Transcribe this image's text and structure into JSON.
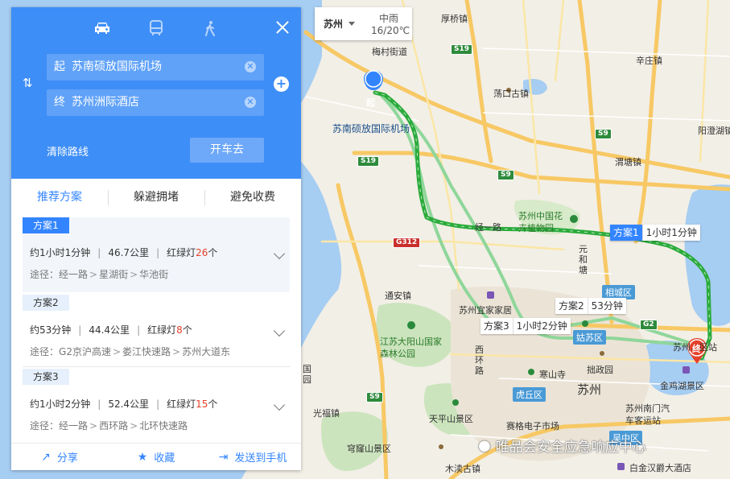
{
  "panel": {
    "modes": [
      {
        "name": "car",
        "icon": "car-icon",
        "active": true
      },
      {
        "name": "bus",
        "icon": "bus-icon",
        "active": false
      },
      {
        "name": "walk",
        "icon": "walk-icon",
        "active": false
      }
    ],
    "origin": {
      "label": "起",
      "value": "苏南硕放国际机场"
    },
    "destination": {
      "label": "终",
      "value": "苏州洲际酒店"
    },
    "clear_route": "清除路线",
    "drive_button": "开车去",
    "preferences": [
      "推荐方案",
      "躲避拥堵",
      "避免收费"
    ],
    "plans": [
      {
        "tag": "方案1",
        "time": "约1小时1分钟",
        "distance": "46.7公里",
        "lights_label": "红绿灯",
        "lights_count": "26",
        "lights_unit": "个",
        "path_label": "途径：",
        "path": [
          "经一路",
          "星湖街",
          "华池街"
        ]
      },
      {
        "tag": "方案2",
        "time": "约53分钟",
        "distance": "44.4公里",
        "lights_label": "红绿灯",
        "lights_count": "8",
        "lights_unit": "个",
        "path_label": "途径：",
        "path": [
          "G2京沪高速",
          "娄江快速路",
          "苏州大道东"
        ]
      },
      {
        "tag": "方案3",
        "time": "约1小时2分钟",
        "distance": "52.4公里",
        "lights_label": "红绿灯",
        "lights_count": "15",
        "lights_unit": "个",
        "path_label": "途径：",
        "path": [
          "经一路",
          "西环路",
          "北环快速路"
        ]
      }
    ],
    "footer": [
      {
        "label": "分享",
        "icon": "share-icon"
      },
      {
        "label": "收藏",
        "icon": "star-icon"
      },
      {
        "label": "发送到手机",
        "icon": "send-to-phone-icon"
      }
    ]
  },
  "weather": {
    "city": "苏州",
    "condition": "中雨",
    "temperature": "16/20℃"
  },
  "map": {
    "start_marker": "起",
    "end_marker": "终",
    "start_name": "苏南硕放国际机场",
    "route_tags": [
      {
        "name": "方案1",
        "time": "1小时1分钟",
        "active": true
      },
      {
        "name": "方案2",
        "time": "53分钟",
        "active": false
      },
      {
        "name": "方案3",
        "time": "1小时2分钟",
        "active": false
      }
    ],
    "labels": {
      "meicun": "梅村街道",
      "houqiao": "厚桥镇",
      "dangkou": "荡口古镇",
      "xinzhuang": "辛庄镇",
      "yangcheng": "阳澄湖镇",
      "weitang": "渭塘镇",
      "botanic": "苏州中国花卉植物园",
      "jingyi": "经一路",
      "yuanhetang": "元和塘",
      "furniture": "苏州宜家家居",
      "dayangshan": "江苏大阳山国家森林公园",
      "tongan": "通安镇",
      "xihuan": "西环路",
      "hanshan": "寒山寺",
      "suzhou": "苏州",
      "zhuozheng": "拙政园",
      "jinji": "金鸡湖景区",
      "tianping": "天平山景区",
      "saige": "赛格电子市场",
      "nanmen": "苏州南门汽车客运站",
      "guangfu": "光福镇",
      "qionglong": "穹窿山景区",
      "mudu": "木渎古镇",
      "baijin": "白金汉爵大酒店",
      "dongtaihu": "东太湖",
      "suzhou_east": "苏州…区站",
      "guoyuan": "国园",
      "huaxi": "华北大…"
    },
    "districts": [
      "相城区",
      "姑苏区",
      "虎丘区",
      "吴中区"
    ],
    "shields": [
      "S19",
      "S9",
      "S19",
      "S9",
      "G312",
      "S9",
      "G2",
      "S9"
    ]
  },
  "watermark": {
    "text": "唯品会安全应急响应中心",
    "icon": "wechat-icon"
  },
  "colors": {
    "panel_blue": "#3e8ef7",
    "route_green": "#2aab3b",
    "alt_route_green": "#8fd69a",
    "accent": "#3385ff",
    "traffic_red": "#e5412a"
  }
}
